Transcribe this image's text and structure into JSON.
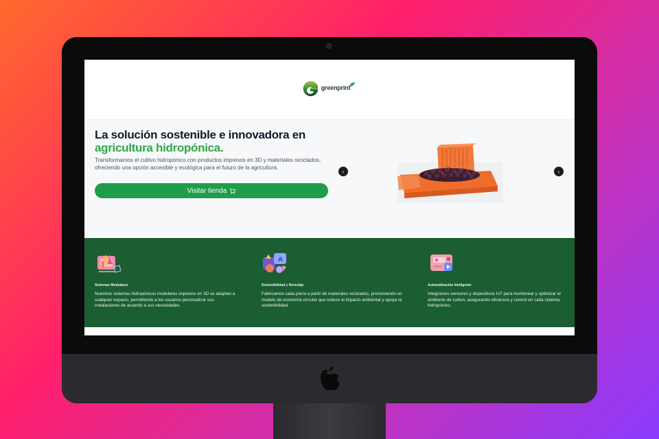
{
  "brand": {
    "name": "greenprint",
    "primary_color": "#1f9d4a",
    "dark_green": "#1b5e31",
    "icon": "greenprint-logo-icon"
  },
  "hero": {
    "title_line1": "La solución sostenible e innovadora en",
    "title_line2": "agricultura hidropónica.",
    "description": "Transformamos el cultivo hidropónico con productos impresos en 3D y materiales reciclados, ofreciendo una opción accesible y ecológica para el futuro de la agricultura.",
    "cta_label": "Visitar tienda",
    "cta_icon": "cart-icon",
    "prev_icon": "chevron-left-icon",
    "next_icon": "chevron-right-icon",
    "prev_glyph": "‹",
    "next_glyph": "›"
  },
  "features": [
    {
      "icon": "modular-systems-icon",
      "title": "Sistemas Modulares",
      "text": "Nuestros sistemas hidropónicos modulares impresos en 3D se adaptan a cualquier espacio, permitiendo a los usuarios personalizar sus instalaciones de acuerdo a sus necesidades."
    },
    {
      "icon": "recycling-icon",
      "title": "Sostenibilidad y Reciclaje",
      "text": "Fabricamos cada pieza a partir de materiales reciclados, promoviendo un modelo de economía circular que reduce el impacto ambiental y apoya la sostenibilidad."
    },
    {
      "icon": "automation-icon",
      "title": "Automatización Inteligente",
      "text": "Integramos sensores y dispositivos IoT para monitorear y optimizar el ambiente de cultivo, asegurando eficiencia y control en cada sistema hidropónico."
    }
  ],
  "device": {
    "logo_icon": "apple-logo-icon"
  }
}
